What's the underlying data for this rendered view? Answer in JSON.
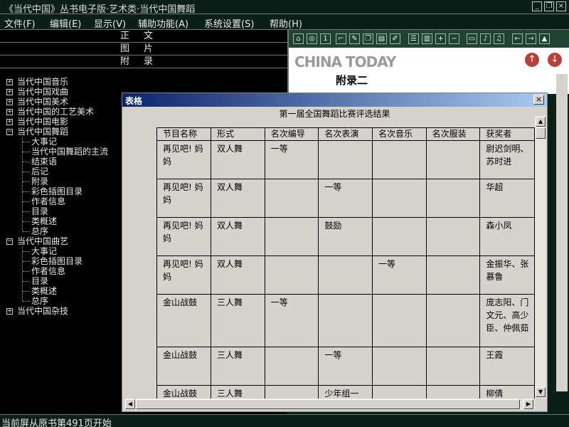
{
  "window": {
    "title": "《当代中国》丛书电子版·艺术类·当代中国舞蹈",
    "controls": {
      "minimize": "_",
      "restore": "❐",
      "close": "×"
    }
  },
  "menubar": [
    "文件(F)",
    "编辑(E)",
    "显示(V)",
    "辅助功能(A)",
    "系统设置(S)",
    "帮助(H)"
  ],
  "nav": [
    "正文",
    "图片",
    "附录"
  ],
  "tree": {
    "top": [
      {
        "label": "当代中国音乐",
        "exp": "+"
      },
      {
        "label": "当代中国戏曲",
        "exp": "+"
      },
      {
        "label": "当代中国美术",
        "exp": "+"
      },
      {
        "label": "当代中国的工艺美术",
        "exp": "+"
      },
      {
        "label": "当代中国电影",
        "exp": "+"
      },
      {
        "label": "当代中国舞蹈",
        "exp": "−"
      }
    ],
    "dance_children": [
      "大事记",
      "当代中国舞蹈的主流",
      "结束语",
      "后记",
      "附录",
      "彩色插图目录",
      "作者信息",
      "目录",
      "类概述",
      "总序"
    ],
    "quyi": {
      "label": "当代中国曲艺",
      "exp": "−"
    },
    "quyi_children": [
      "大事记",
      "彩色插图目录",
      "作者信息",
      "目录",
      "类概述",
      "总序"
    ],
    "zaji": {
      "label": "当代中国杂技",
      "exp": "+"
    }
  },
  "toolbar_icons": [
    "home-icon",
    "zoom-page-icon",
    "page-1-icon",
    "select-icon",
    "pen-icon",
    "copy-icon",
    "paste-icon",
    "edit-icon",
    "list-icon",
    "book-icon",
    "zoom-in-icon",
    "zoom-out-icon",
    "fit-icon",
    "speaker-icon",
    "audio-icon",
    "back-icon",
    "forward-icon",
    "up-icon"
  ],
  "viewer": {
    "logo": "CHINA TODAY",
    "appendix_title": "附录二",
    "up_symbol": "↑",
    "down_symbol": "↓"
  },
  "dialog": {
    "title": "表格",
    "close": "×",
    "caption": "第一届全国舞蹈比赛评选结果",
    "columns": [
      "节目名称",
      "形式",
      "名次编导",
      "名次表演",
      "名次音乐",
      "名次服装",
      "获奖者"
    ],
    "rows": [
      [
        "再见吧! 妈妈",
        "双人舞",
        "一等",
        "",
        "",
        "",
        "尉迟剑明、苏时进"
      ],
      [
        "再见吧! 妈妈",
        "双人舞",
        "",
        "一等",
        "",
        "",
        "华超"
      ],
      [
        "再见吧! 妈妈",
        "双人舞",
        "",
        "鼓励",
        "",
        "",
        "森小凤"
      ],
      [
        "再见吧! 妈妈",
        "双人舞",
        "",
        "",
        "一等",
        "",
        "金振华、张慕鲁"
      ],
      [
        "金山战鼓",
        "三人舞",
        "一等",
        "",
        "",
        "",
        "庞志阳、门文元、高少臣、仲佩茹"
      ],
      [
        "金山战鼓",
        "三人舞",
        "",
        "一等",
        "",
        "",
        "王霞"
      ],
      [
        "金山战鼓",
        "三人舞",
        "",
        "少年组一",
        "",
        "",
        "柳倩"
      ]
    ]
  },
  "status": "当前屏从原书第491页开始",
  "colors": {
    "background": "#0b1f18",
    "toolbar": "#1f4232",
    "dialog": "#d6d3ce",
    "title_gradient_start": "#0a246a"
  }
}
